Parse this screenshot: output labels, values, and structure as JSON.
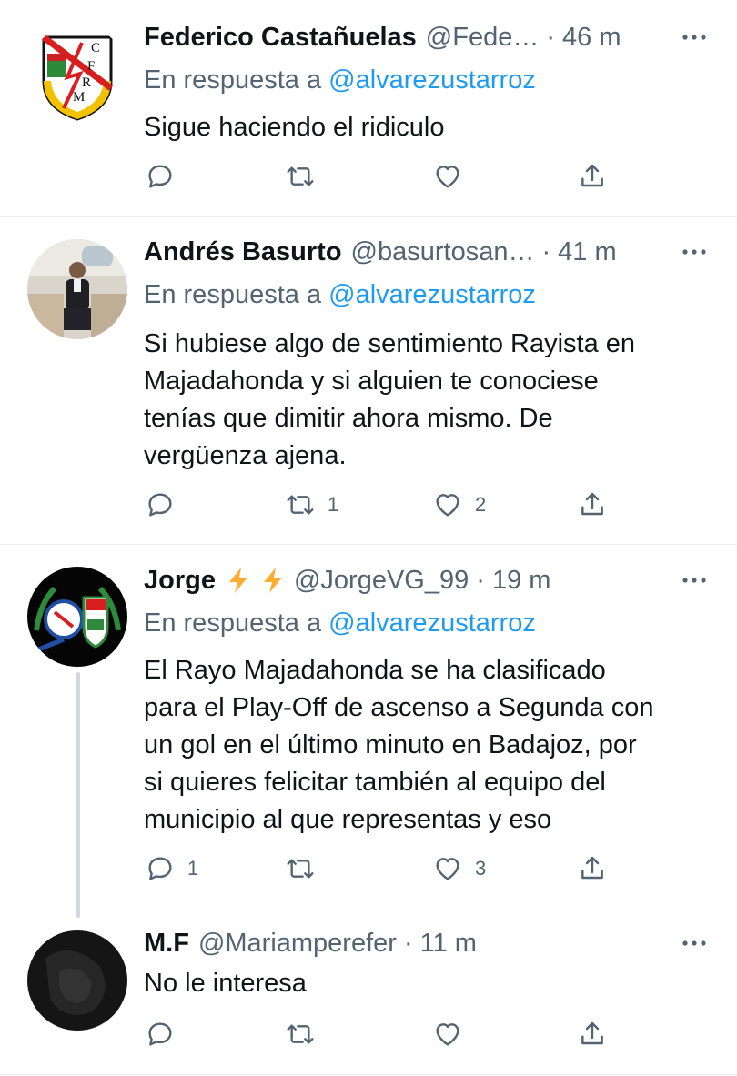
{
  "replying_prefix": "En respuesta a",
  "tweets": [
    {
      "name": "Federico Castañuelas",
      "handle": "@Fede…",
      "time": "46 m",
      "reply_to": "@alvarezustarroz",
      "text": [
        "Sigue haciendo el ridiculo"
      ],
      "counts": {
        "reply": "",
        "retweet": "",
        "like": ""
      },
      "avatar_letters": [
        "C",
        "F",
        "R",
        "M"
      ]
    },
    {
      "name": "Andrés Basurto",
      "handle": "@basurtosan…",
      "time": "41 m",
      "reply_to": "@alvarezustarroz",
      "text": [
        "Si hubiese algo de sentimiento Rayista en",
        "Majadahonda y si alguien te conociese",
        "tenías que dimitir ahora mismo. De",
        "vergüenza ajena."
      ],
      "counts": {
        "reply": "",
        "retweet": "1",
        "like": "2"
      }
    },
    {
      "name": "Jorge",
      "handle": "@JorgeVG_99",
      "time": "19 m",
      "reply_to": "@alvarezustarroz",
      "text": [
        "El Rayo Majadahonda se ha clasificado",
        "para el Play-Off de ascenso a Segunda con",
        "un gol en el último minuto en Badajoz, por",
        "si quieres felicitar también al equipo del",
        "municipio al que representas y eso"
      ],
      "counts": {
        "reply": "1",
        "retweet": "",
        "like": "3"
      }
    },
    {
      "name": "M.F",
      "handle": "@Mariamperefer",
      "time": "11 m",
      "reply_to": "",
      "text": [
        "No le interesa"
      ],
      "counts": {
        "reply": "",
        "retweet": "",
        "like": ""
      }
    }
  ],
  "colors": {
    "link": "#1d9bf0",
    "secondary": "#536471",
    "bolt": "#ffac33"
  }
}
